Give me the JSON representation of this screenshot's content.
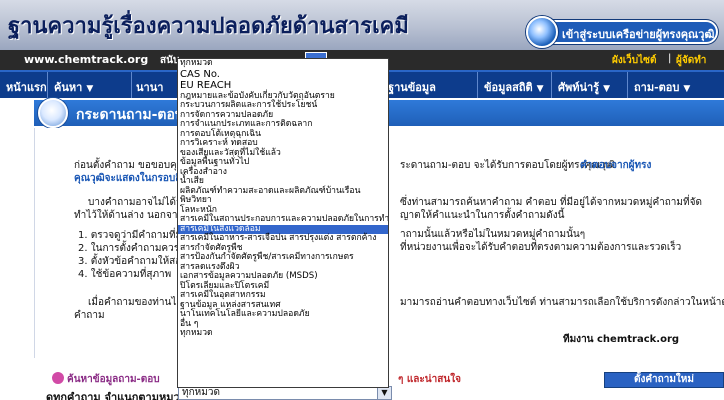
{
  "header": {
    "title": "ฐานความรู้เรื่องความปลอดภัยด้านสารเคมี",
    "login_label": "เข้าสู่ระบบเครือข่ายผู้ทรงคุณวุฒิ"
  },
  "topbar": {
    "site_url": "www.chemtrack.org",
    "middle_text": "สนับ",
    "site_map": "ผังเว็บไซต์",
    "separator": "|",
    "contact": "ผู้จัดทำ"
  },
  "nav": {
    "items": [
      {
        "label": "หน้าแรก",
        "has_arrow": false
      },
      {
        "label": "ค้นหา",
        "has_arrow": true
      },
      {
        "label": "นานาสาระ",
        "has_arrow": false
      },
      {
        "label": "",
        "has_arrow": false
      },
      {
        "label": "ฐานข้อมูลเคมีภัณฑ์",
        "has_arrow": false
      },
      {
        "label": "ข้อมูลสถิติ",
        "has_arrow": true
      },
      {
        "label": "ศัพท์น่ารู้",
        "has_arrow": true
      },
      {
        "label": "ถาม-ตอบ",
        "has_arrow": true
      }
    ]
  },
  "section": {
    "title": "กระดานถาม-ตอบ"
  },
  "content": {
    "p1_left": "ก่อนตั้งคำถาม ขอขอบคุณ",
    "p1_left_hl": "คุณวุฒิจะแสดงในกรอบสีเขี",
    "p1_right": "ระดานถาม-ตอบ จะได้รับการตอบโดยผู้ทรงคุณวุฒิ",
    "p1_right_hl": "คำตอบจากผู้ทรง",
    "p2_left_1": "บางคำถามอาจไม่ได้รับการ",
    "p2_left_2": "ทำไว้ให้ด้านล่าง นอกจากนี้เพ",
    "p2_right_1": "ซึ่งท่านสามารถค้นหาคำถาม คำตอบ ที่มีอยู่ได้จากหมวดหมู่คำถามที่จัด",
    "p2_right_2": "ญาตให้คำแนะนำในการตั้งคำถามดังนี้",
    "list": [
      "1.  ตรวจดูว่ามีคำถามที่มี",
      "2.  ในการตั้งคำถามควรบ",
      "3.  ตั้งหัวข้อคำถามให้สอดค",
      "4.  ใช้ข้อความที่สุภาพ"
    ],
    "list_right_1": "าถามนั้นแล้วหรือไม่ในหมวดหมู่คำถามนั้นๆ",
    "list_right_2": "ที่หน่วยงานเพื่อจะได้รับคำตอบที่ตรงตามความต้องการและรวดเร็ว",
    "p3_left_1": "เมื่อคำถามของท่านได้รับ",
    "p3_left_2": "คำถาม",
    "p3_right": "มามารถอ่านคำตอบทางเว็บไซต์ ท่านสามารถเลือกใช้บริการดังกล่าวในหน้าตั้ง",
    "signature": "ทีมงาน chemtrack.org"
  },
  "search": {
    "title": "ค้นหาข้อมูลถาม-ตอบ",
    "tail": "ๆ และน่าสนใจ",
    "row_label": "ดูทุกคำถาม จำแนกตามหมวด:",
    "selected": "ทุกหมวด",
    "new_question": "ตั้งคำถามใหม่"
  },
  "dropdown": {
    "selected_index": 17,
    "options": [
      "ทุกหมวด",
      "CAS No.",
      "EU REACH",
      "กฎหมายและข้อบังคับเกี่ยวกับวัตถุอันตราย",
      "กระบวนการผลิตและการใช้ประโยชน์",
      "การจัดการความปลอดภัย",
      "การจำแนกประเภทและการติดฉลาก",
      "การตอบโต้เหตุฉุกเฉิน",
      "การวิเคราะห์ ทดสอบ",
      "ของเสียและวัสดุที่ไม่ใช้แล้ว",
      "ข้อมูลพื้นฐานทั่วไป",
      "เครื่องสำอาง",
      "น้ำเสีย",
      "ผลิตภัณฑ์ทำความสะอาดและผลิตภัณฑ์บ้านเรือน",
      "พิษวิทยา",
      "โลหะหนัก",
      "สารเคมีในสถานประกอบการและความปลอดภัยในการทำงาน",
      "สารเคมีในสิ่งแวดล้อม",
      "สารเคมีในอาหาร-สารเจือปน สารปรุงแต่ง สารตกค้าง",
      "สารกำจัดศัตรูพืช",
      "สารป้องกันกำจัดศัตรูพืช/สารเคมีทางการเกษตร",
      "สารลดแรงตึงผิว",
      "เอกสารข้อมูลความปลอดภัย (MSDS)",
      "ปิโตรเลียมและปิโตรเคมี",
      "สารเคมีในอุตสาหกรรม",
      "ฐานข้อมูล แหล่งสารสนเทศ",
      "นาโนเทคโนโลยีและความปลอดภัย",
      "อื่น ๆ",
      "ทุกหมวด"
    ]
  },
  "colors": {
    "nav_bg": "#0d3c8c",
    "section_header": "#1f5fb8",
    "highlight_text": "#1a57b5",
    "selection_bg": "#3366cc"
  }
}
